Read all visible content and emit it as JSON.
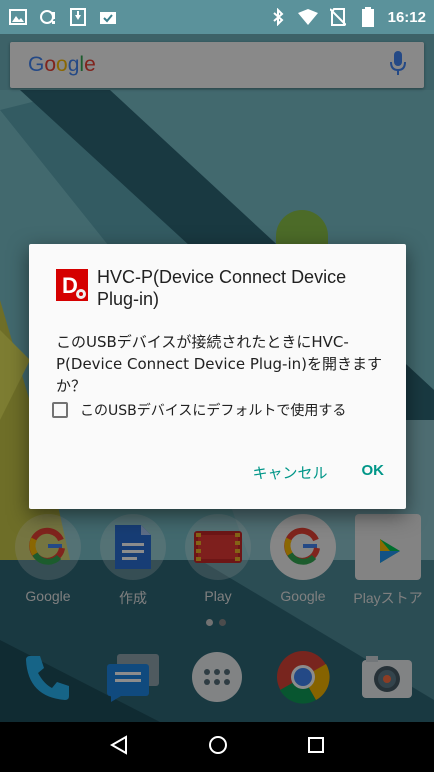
{
  "status_bar": {
    "time": "16:12",
    "left_icons": [
      "image-icon",
      "sync-error-icon",
      "download-icon",
      "tray-check-icon"
    ],
    "right_icons": [
      "bluetooth-icon",
      "wifi-icon",
      "no-sim-icon",
      "battery-icon"
    ]
  },
  "search_bar": {
    "logo_text": "Google",
    "logo_colors": [
      "#4285F4",
      "#EA4335",
      "#FBBC05",
      "#4285F4",
      "#34A853",
      "#EA4335"
    ],
    "mic_icon": "mic-icon"
  },
  "dialog": {
    "title": "HVC-P(Device Connect Device Plug-in)",
    "icon_letter": "D",
    "message": "このUSBデバイスが接続されたときにHVC-P(Device Connect Device Plug-in)を開きますか？",
    "checkbox_label": "このUSBデバイスにデフォルトで使用する",
    "checkbox_checked": false,
    "cancel_label": "キャンセル",
    "ok_label": "OK",
    "accent_color": "#009688"
  },
  "home": {
    "apps": [
      {
        "label": "Google",
        "icon": "google-folder-icon"
      },
      {
        "label": "作成",
        "icon": "docs-icon"
      },
      {
        "label": "Play",
        "icon": "play-movies-icon"
      },
      {
        "label": "Google",
        "icon": "google-icon"
      },
      {
        "label": "Playストア",
        "icon": "play-store-icon"
      }
    ],
    "dock": [
      "phone-icon",
      "messages-icon",
      "app-drawer-icon",
      "chrome-icon",
      "camera-icon"
    ]
  },
  "nav_bar": {
    "buttons": [
      "back-icon",
      "home-icon",
      "recents-icon"
    ]
  }
}
